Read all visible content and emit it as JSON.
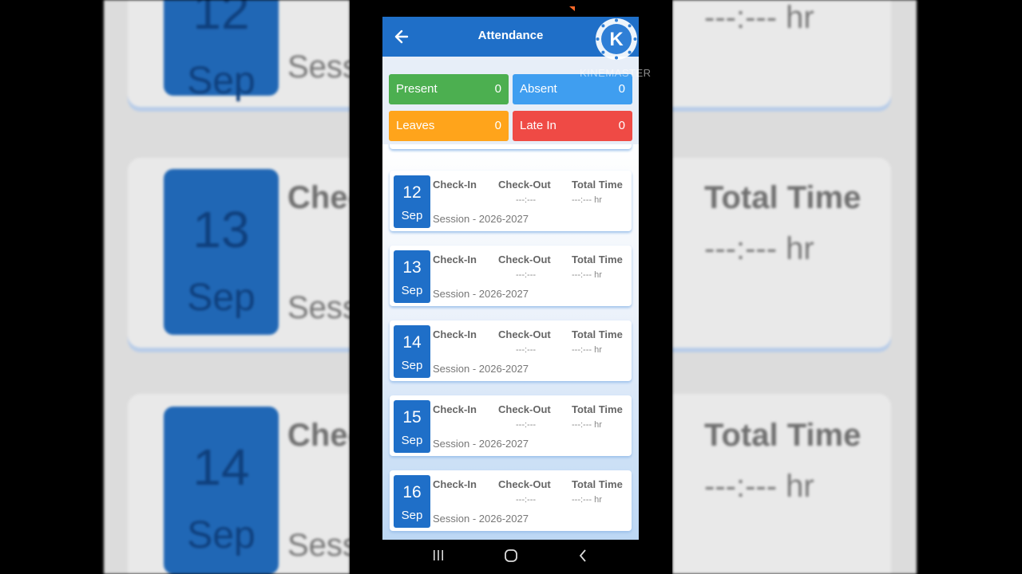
{
  "app_bar": {
    "title": "Attendance"
  },
  "stats": [
    {
      "label": "Present",
      "value": "0",
      "color": "#4caf50"
    },
    {
      "label": "Absent",
      "value": "0",
      "color": "#3f9ef0"
    },
    {
      "label": "Leaves",
      "value": "0",
      "color": "#ffa41b"
    },
    {
      "label": "Late In",
      "value": "0",
      "color": "#ef4a45"
    }
  ],
  "columns": {
    "check_in": "Check-In",
    "check_out": "Check-Out",
    "total_time": "Total Time"
  },
  "records": [
    {
      "day": "12",
      "month": "Sep",
      "check_in": "",
      "check_out": "---:---",
      "total_time": "---:--- hr",
      "session": "Session - 2026-2027"
    },
    {
      "day": "13",
      "month": "Sep",
      "check_in": "",
      "check_out": "---:---",
      "total_time": "---:--- hr",
      "session": "Session - 2026-2027"
    },
    {
      "day": "14",
      "month": "Sep",
      "check_in": "",
      "check_out": "---:---",
      "total_time": "---:--- hr",
      "session": "Session - 2026-2027"
    },
    {
      "day": "15",
      "month": "Sep",
      "check_in": "",
      "check_out": "---:---",
      "total_time": "---:--- hr",
      "session": "Session - 2026-2027"
    },
    {
      "day": "16",
      "month": "Sep",
      "check_in": "",
      "check_out": "---:---",
      "total_time": "---:--- hr",
      "session": "Session - 2026-2027"
    }
  ],
  "watermark": {
    "text": "KINEMASTER",
    "letter": "K"
  },
  "background": {
    "left_days": [
      "12",
      "13",
      "14"
    ],
    "month": "Sep",
    "check_prefix": "Chec",
    "session_prefix": "Sessi",
    "total_time": "Total Time",
    "time_value": "---:--- hr"
  },
  "icons": {
    "back": "arrow-left-icon",
    "recents": "recents-icon",
    "home": "home-icon",
    "nav_back": "chevron-left-icon"
  }
}
